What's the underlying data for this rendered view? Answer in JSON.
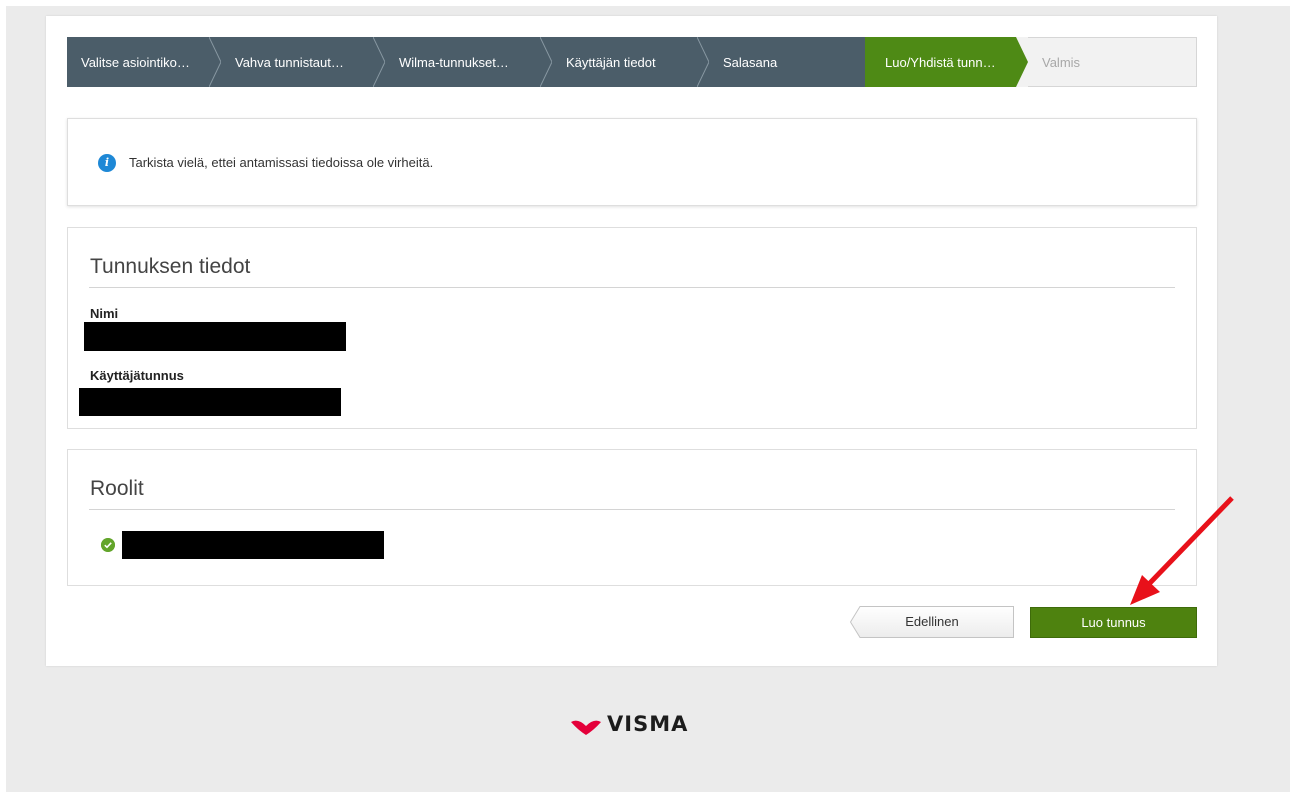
{
  "wizard": {
    "steps": [
      {
        "label": "Valitse asiointiko…",
        "state": "done"
      },
      {
        "label": "Vahva tunnistaut…",
        "state": "done"
      },
      {
        "label": "Wilma-tunnukset…",
        "state": "done"
      },
      {
        "label": "Käyttäjän tiedot",
        "state": "done"
      },
      {
        "label": "Salasana",
        "state": "done"
      },
      {
        "label": "Luo/Yhdistä tunn…",
        "state": "active"
      },
      {
        "label": "Valmis",
        "state": "todo"
      }
    ]
  },
  "info": {
    "icon": "info-icon",
    "message": "Tarkista vielä, ettei antamissasi tiedoissa ole virheitä."
  },
  "account_details": {
    "title": "Tunnuksen tiedot",
    "name_label": "Nimi",
    "username_label": "Käyttäjätunnus"
  },
  "roles": {
    "title": "Roolit",
    "icon": "check-circle-icon"
  },
  "actions": {
    "previous_label": "Edellinen",
    "create_label": "Luo tunnus"
  },
  "brand": {
    "logo_text": "VISMA",
    "logo_color": "#e4003a"
  },
  "colors": {
    "step_done": "#4b5d69",
    "step_active": "#4e8a15",
    "primary_button": "#4e820f",
    "info_icon": "#1e88d6",
    "annotation_arrow": "#e8111a"
  }
}
